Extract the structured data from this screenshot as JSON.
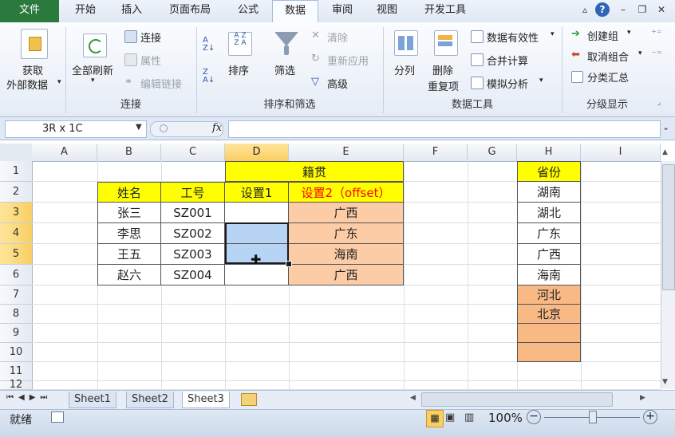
{
  "tabs": [
    "文件",
    "开始",
    "插入",
    "页面布局",
    "公式",
    "数据",
    "审阅",
    "视图",
    "开发工具"
  ],
  "ribbon": {
    "get_external": [
      "获取",
      "外部数据"
    ],
    "refresh_all": "全部刷新",
    "connections": "连接",
    "properties": "属性",
    "edit_links": "编辑链接",
    "group_connections": "连接",
    "sort": "排序",
    "filter": "筛选",
    "clear": "清除",
    "reapply": "重新应用",
    "advanced": "高级",
    "group_sort_filter": "排序和筛选",
    "text_to_columns": "分列",
    "remove_dup": [
      "删除",
      "重复项"
    ],
    "data_validation": "数据有效性",
    "consolidate": "合并计算",
    "what_if": "模拟分析",
    "group_data_tools": "数据工具",
    "group": "创建组",
    "ungroup": "取消组合",
    "subtotal": "分类汇总",
    "group_outline": "分级显示"
  },
  "formula_bar": {
    "name_box": "3R x 1C",
    "fx": "fx",
    "value": ""
  },
  "columns": [
    "A",
    "B",
    "C",
    "D",
    "E",
    "F",
    "G",
    "H",
    "I"
  ],
  "rows": [
    "1",
    "2",
    "3",
    "4",
    "5",
    "6",
    "7",
    "8",
    "9",
    "10",
    "11",
    "12"
  ],
  "table": {
    "header_top": "籍贯",
    "col_name": "姓名",
    "col_id": "工号",
    "col_set1": "设置1",
    "col_set2": "设置2（offset）",
    "rows": [
      {
        "name": "张三",
        "id": "SZ001",
        "set1": "",
        "set2": "广西"
      },
      {
        "name": "李思",
        "id": "SZ002",
        "set1": "",
        "set2": "广东"
      },
      {
        "name": "王五",
        "id": "SZ003",
        "set1": "",
        "set2": "海南"
      },
      {
        "name": "赵六",
        "id": "SZ004",
        "set1": "",
        "set2": "广西"
      }
    ]
  },
  "province_list": {
    "header": "省份",
    "items": [
      "湖南",
      "湖北",
      "广东",
      "广西",
      "海南",
      "河北",
      "北京",
      "",
      ""
    ]
  },
  "sheets": [
    "Sheet1",
    "Sheet2",
    "Sheet3"
  ],
  "status": {
    "ready": "就绪",
    "zoom": "100%"
  },
  "colors": {
    "yellow": "#ffff00",
    "peach": "#fbcca6",
    "orange": "#f9b985",
    "selection": "#b8d4f5",
    "red_text": "#ff0000"
  }
}
